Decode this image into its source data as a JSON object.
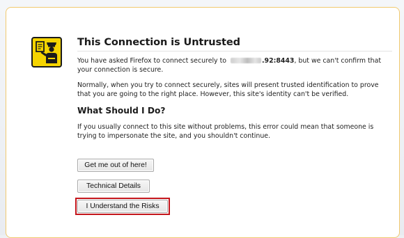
{
  "page": {
    "title": "This Connection is Untrusted",
    "intro_text_before_host": "You have asked Firefox to connect securely to",
    "host_visible_suffix": ".92:8443",
    "intro_text_after_host": ", but we can't confirm that your connection is secure.",
    "explanation": "Normally, when you try to connect securely, sites will present trusted identification to prove that you are going to the right place. However, this site's identity can't be verified.",
    "subtitle": "What Should I Do?",
    "advice": "If you usually connect to this site without problems, this error could mean that someone is trying to impersonate the site, and you shouldn't continue."
  },
  "buttons": {
    "get_me_out": "Get me out of here!",
    "technical_details": "Technical Details",
    "understand_risks": "I Understand the Risks"
  },
  "icons": {
    "warning": "security-officer-warning-icon"
  },
  "colors": {
    "panel_border": "#f1c96e",
    "icon_background": "#f5d400",
    "highlight_border": "#c4161c"
  }
}
